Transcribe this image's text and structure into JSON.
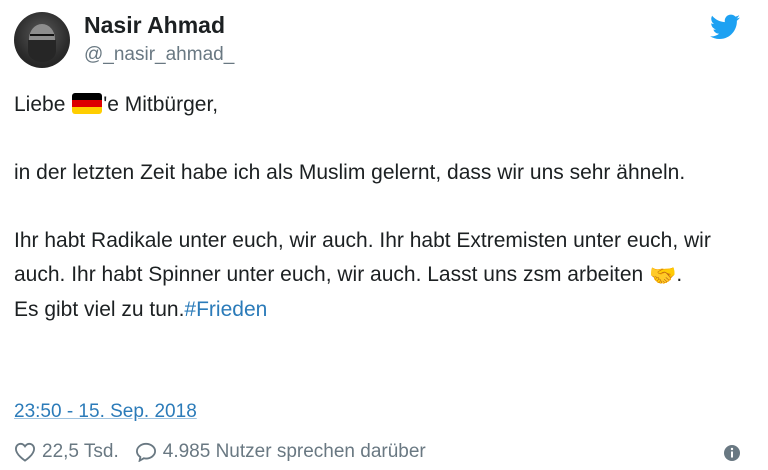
{
  "author": {
    "name": "Nasir Ahmad",
    "handle": "@_nasir_ahmad_"
  },
  "tweet": {
    "greeting_before": "Liebe ",
    "greeting_after": "'e Mitbürger,",
    "flag_icon": "germany-flag-icon",
    "line2": "in der letzten Zeit habe ich als Muslim gelernt, dass wir uns sehr ähneln.",
    "line3": "Ihr habt Radikale unter euch, wir auch. Ihr habt Extremisten unter euch, wir auch. Ihr habt Spinner unter euch, wir auch. Lasst uns zsm arbeiten ",
    "handshake_emoji": "🤝",
    "line3_end": ".",
    "line4": "Es gibt viel zu tun.",
    "hashtag": "#Frieden"
  },
  "timestamp": "23:50 - 15. Sep. 2018",
  "footer": {
    "likes": "22,5 Tsd.",
    "talking": "4.985 Nutzer sprechen darüber",
    "like_icon": "heart-icon",
    "reply_icon": "comment-icon",
    "info_icon": "info-icon"
  },
  "colors": {
    "link": "#2b7bb9",
    "secondary": "#697882",
    "twitter_blue": "#1da1f2"
  }
}
